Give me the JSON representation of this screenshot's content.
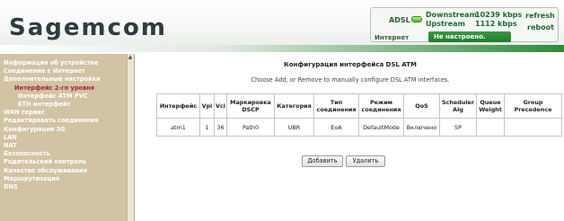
{
  "header": {
    "logo": "Sagemcom",
    "adsl_label": "ADSL",
    "downstream_label": "Downstream",
    "downstream_value": "10239 kbps",
    "upstream_label": "Upstream",
    "upstream_value": "1112 kbps",
    "refresh_label": "refresh",
    "reboot_label": "reboot",
    "internet_label": "Интернет",
    "internet_status": "Не настроено."
  },
  "sidebar": {
    "items": [
      {
        "label": "Информация об устройстве",
        "level": "top",
        "active": false
      },
      {
        "label": "Соединение с Интернет",
        "level": "top",
        "active": false
      },
      {
        "label": "Дополнительные настройки",
        "level": "top",
        "active": false
      },
      {
        "label": "Интерфейс 2-го уровня",
        "level": "sub",
        "active": true
      },
      {
        "label": "Интерфейс ATM PVC",
        "level": "sub2",
        "active": false
      },
      {
        "label": "ETH интерфейс",
        "level": "sub2",
        "active": false
      },
      {
        "label": "WAN сервис",
        "level": "top",
        "active": false
      },
      {
        "label": "Редактировать соединения",
        "level": "top",
        "active": false
      },
      {
        "label": "Конфигурация 3G",
        "level": "top",
        "active": false
      },
      {
        "label": "LAN",
        "level": "top",
        "active": false
      },
      {
        "label": "NAT",
        "level": "top",
        "active": false
      },
      {
        "label": "Безопасность",
        "level": "top",
        "active": false
      },
      {
        "label": "Родительский контроль",
        "level": "top",
        "active": false
      },
      {
        "label": "Качество обслуживания",
        "level": "top",
        "active": false
      },
      {
        "label": "Маршрутизация",
        "level": "top",
        "active": false
      },
      {
        "label": "DNS",
        "level": "top",
        "active": false
      }
    ]
  },
  "main": {
    "title": "Конфигурация интерфейса DSL ATM",
    "subtitle": "Choose Add, or Remove to manually configure DSL ATM interfaces.",
    "columns": [
      "Интерфейс",
      "Vpi",
      "Vci",
      "Маркировка DSCP",
      "Категория",
      "Тип соединения",
      "Режим соединения",
      "QoS",
      "Scheduler Alg",
      "Queue Weight",
      "Group Precedence"
    ],
    "rows": [
      [
        "atm1",
        "1",
        "36",
        "Path0",
        "UBR",
        "EoA",
        "DefaultMode",
        "Включено",
        "SP",
        "",
        ""
      ]
    ],
    "add_label": "Добавить",
    "remove_label": "Удалить"
  },
  "colors": {
    "sidebar_bg": "#d2c3a4",
    "active_nav": "#a6263d",
    "brand_green": "#2f8a3a"
  }
}
